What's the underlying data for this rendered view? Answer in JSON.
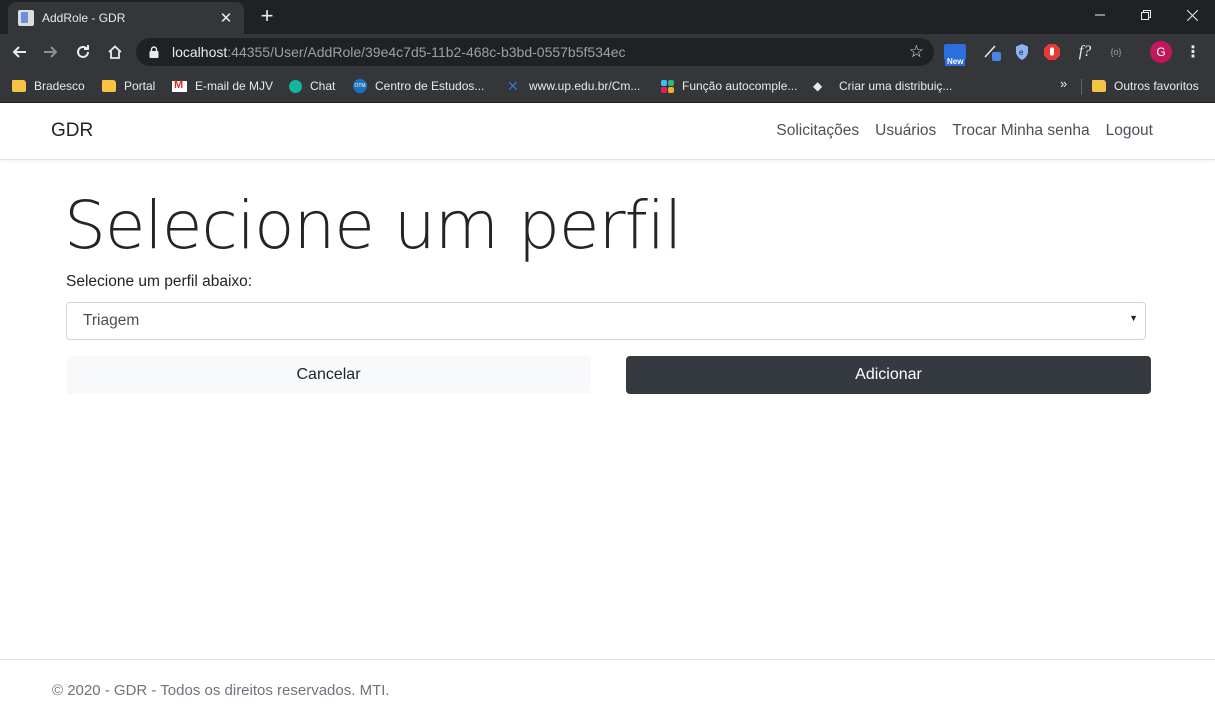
{
  "browser": {
    "tab_title": "AddRole - GDR",
    "tab_close": "✕",
    "new_tab": "+",
    "url_host": "localhost",
    "url_rest": ":44355/User/AddRole/39e4c7d5-11b2-468c-b3bd-0557b5f534ec",
    "extension_new_label": "New",
    "extension_fx_label": "f?",
    "extension_obj_label": "{o}",
    "profile_initial": "G",
    "bookmarks": [
      {
        "label": "Bradesco",
        "icon": "folder-icon"
      },
      {
        "label": "Portal",
        "icon": "folder-icon"
      },
      {
        "label": "E-mail de MJV",
        "icon": "gmail-icon"
      },
      {
        "label": "Chat",
        "icon": "chat-icon"
      },
      {
        "label": "Centro de Estudos...",
        "icon": "otm-icon"
      },
      {
        "label": "www.up.edu.br/Cm...",
        "icon": "up-icon"
      },
      {
        "label": "Função autocomple...",
        "icon": "slack-icon"
      },
      {
        "label": "Criar uma distribuiç...",
        "icon": "github-icon"
      }
    ],
    "bookmarks_more": "»",
    "other_bookmarks": "Outros favoritos",
    "colors": {
      "tabstrip": "#202124",
      "toolbar": "#35363a",
      "avatar": "#c2185b"
    }
  },
  "navbar": {
    "brand": "GDR",
    "links": [
      "Solicitações",
      "Usuários",
      "Trocar Minha senha",
      "Logout"
    ]
  },
  "main": {
    "title": "Selecione um perfil",
    "label": "Selecione um perfil abaixo:",
    "select_value": "Triagem",
    "cancel_label": "Cancelar",
    "add_label": "Adicionar",
    "colors": {
      "primary_button": "#343a40",
      "secondary_button": "#f8f9fa"
    }
  },
  "footer": {
    "text": "© 2020 - GDR - Todos os direitos reservados. MTI."
  }
}
